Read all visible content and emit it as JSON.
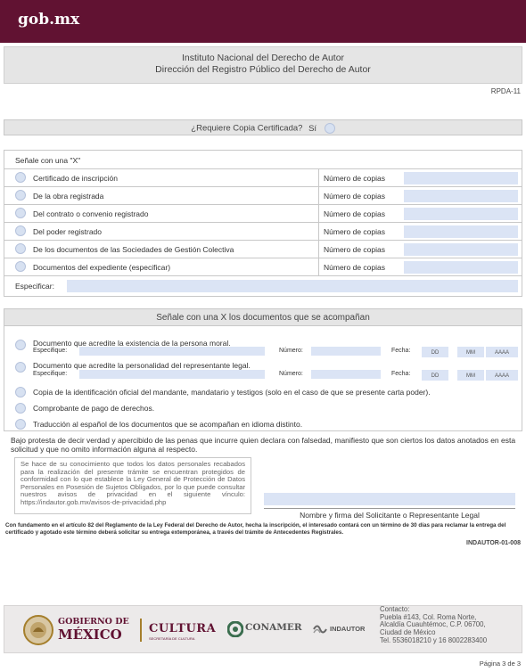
{
  "brand": "gob.mx",
  "header": {
    "institute": "Instituto Nacional del Derecho de Autor",
    "directorate": "Dirección del Registro Público del Derecho de Autor"
  },
  "form_code": "RPDA-11",
  "certified_copy": {
    "question": "¿Requiere Copia Certificada?",
    "answer_label": "Sí"
  },
  "section1": {
    "instruction": "Señale con una \"X\"",
    "copies_label": "Número de copias",
    "items": [
      "Certificado de inscripción",
      "De la obra registrada",
      "Del contrato o convenio registrado",
      "Del poder registrado",
      "De los documentos de las Sociedades de Gestión Colectiva",
      "Documentos del expediente (especificar)"
    ],
    "specify_label": "Especificar:"
  },
  "section2": {
    "title": "Señale con una X los documentos que se acompañan",
    "doc1": "Documento que acredite la existencia de la persona moral.",
    "doc2": "Documento que acredite la personalidad del representante legal.",
    "specify_label": "Especifique:",
    "number_label": "Número:",
    "date_label": "Fecha:",
    "date_dd": "DD",
    "date_mm": "MM",
    "date_yyyy": "AAAA",
    "doc3": "Copia de la identificación oficial del mandante, mandatario y testigos (solo en el caso de que se presente carta poder).",
    "doc4": "Comprobante de pago de derechos.",
    "doc5": "Traducción al español de los documentos que se acompañan en idioma distinto."
  },
  "declaration": "Bajo protesta de decir verdad y apercibido de las penas que incurre quien declara con falsedad, manifiesto que son ciertos los datos anotados en esta solicitud y que no omito información alguna al respecto.",
  "privacy_notice": "Se hace de su conocimiento que todos los datos personales recabados para la realización del presente trámite se encuentran protegidos de conformidad con lo que establece la Ley General de Protección de Datos Personales en Posesión de Sujetos Obligados, por lo que puede consultar nuestros avisos de privacidad en el siguiente vínculo: https://indautor.gob.mx/avisos-de-privacidad.php",
  "signature_label": "Nombre y firma del Solicitante o Representante Legal",
  "footnote": "Con fundamento en el artículo 82 del Reglamento de la Ley Federal del Derecho de Autor, hecha la inscripción, el interesado contará con un término de 30 días para reclamar la entrega del certificado y agotado este término deberá solicitar su entrega extemporánea, a través del trámite de Antecedentes Registrales.",
  "form_code_2": "INDAUTOR-01-008",
  "footer": {
    "logo_gobierno": "GOBIERNO DE",
    "logo_mexico": "MÉXICO",
    "logo_cultura": "CULTURA",
    "logo_cultura_sub": "SECRETARÍA DE CULTURA",
    "logo_conamer": "CONAMER",
    "logo_indautor": "INDAUTOR",
    "contact_title": "Contacto:",
    "contact_lines": [
      "Puebla #143, Col. Roma Norte,",
      "Alcaldía Cuauhtémoc, C.P. 06700,",
      "Ciudad de México",
      "Tel. 5536018210 y 16  8002283400"
    ]
  },
  "page_label": "Página 3 de 3",
  "colors": {
    "brand": "#611232",
    "field": "#dbe4f5",
    "gold": "#a57f2c"
  }
}
